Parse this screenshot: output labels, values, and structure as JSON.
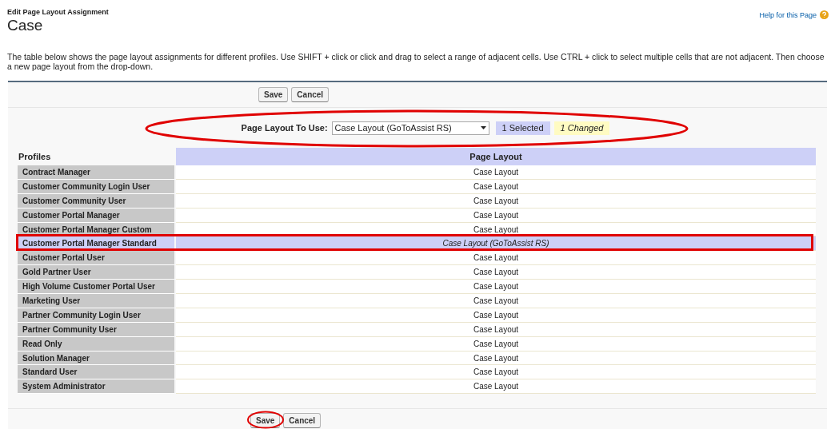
{
  "header": {
    "breadcrumb": "Edit Page Layout Assignment",
    "title": "Case",
    "help_link": "Help for this Page"
  },
  "description": "The table below shows the page layout assignments for different profiles. Use SHIFT + click or click and drag to select a range of adjacent cells. Use CTRL + click to select multiple cells that are not adjacent. Then choose a new page layout from the drop-down.",
  "top_buttons": [
    "Save",
    "Cancel"
  ],
  "layout_picker": {
    "label": "Page Layout To Use:",
    "value": "Case Layout (GoToAssist RS)",
    "selected_count": "1 Selected",
    "changed_count": "1 Changed"
  },
  "table": {
    "columns": [
      "Profiles",
      "Page Layout"
    ],
    "rows": [
      {
        "profile": "Contract Manager",
        "layout": "Case Layout",
        "selected": false
      },
      {
        "profile": "Customer Community Login User",
        "layout": "Case Layout",
        "selected": false
      },
      {
        "profile": "Customer Community User",
        "layout": "Case Layout",
        "selected": false
      },
      {
        "profile": "Customer Portal Manager",
        "layout": "Case Layout",
        "selected": false
      },
      {
        "profile": "Customer Portal Manager Custom",
        "layout": "Case Layout",
        "selected": false
      },
      {
        "profile": "Customer Portal Manager Standard",
        "layout": "Case Layout (GoToAssist RS)",
        "selected": true
      },
      {
        "profile": "Customer Portal User",
        "layout": "Case Layout",
        "selected": false
      },
      {
        "profile": "Gold Partner User",
        "layout": "Case Layout",
        "selected": false
      },
      {
        "profile": "High Volume Customer Portal User",
        "layout": "Case Layout",
        "selected": false
      },
      {
        "profile": "Marketing User",
        "layout": "Case Layout",
        "selected": false
      },
      {
        "profile": "Partner Community Login User",
        "layout": "Case Layout",
        "selected": false
      },
      {
        "profile": "Partner Community User",
        "layout": "Case Layout",
        "selected": false
      },
      {
        "profile": "Read Only",
        "layout": "Case Layout",
        "selected": false
      },
      {
        "profile": "Solution Manager",
        "layout": "Case Layout",
        "selected": false
      },
      {
        "profile": "Standard User",
        "layout": "Case Layout",
        "selected": false
      },
      {
        "profile": "System Administrator",
        "layout": "Case Layout",
        "selected": false
      }
    ]
  },
  "bottom_buttons": [
    "Save",
    "Cancel"
  ]
}
